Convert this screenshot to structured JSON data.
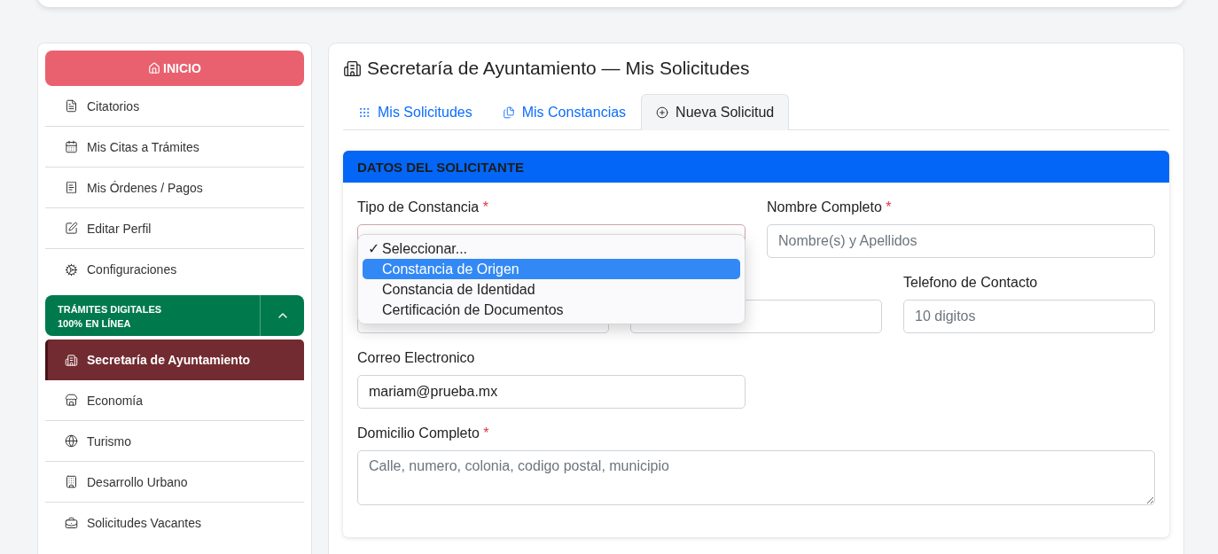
{
  "sidebar": {
    "home_button": "INICIO",
    "items": [
      {
        "label": "Citatorios"
      },
      {
        "label": "Mis Citas a Trámites"
      },
      {
        "label": "Mis Órdenes / Pagos"
      },
      {
        "label": "Editar Perfil"
      },
      {
        "label": "Configuraciones"
      }
    ],
    "section": {
      "title_lines": [
        "TRÁMITES DIGITALES",
        "100% EN LÍNEA"
      ],
      "expanded": true,
      "items": [
        {
          "label": "Secretaría de Ayuntamiento",
          "selected": true
        },
        {
          "label": "Economía",
          "selected": false
        },
        {
          "label": "Turismo",
          "selected": false
        },
        {
          "label": "Desarrollo Urbano",
          "selected": false
        },
        {
          "label": "Solicitudes Vacantes",
          "selected": false
        }
      ]
    }
  },
  "page": {
    "title": "Secretaría de Ayuntamiento — Mis Solicitudes",
    "tabs": [
      {
        "label": "Mis Solicitudes",
        "selected": false
      },
      {
        "label": "Mis Constancias",
        "selected": false
      },
      {
        "label": "Nueva Solicitud",
        "selected": true
      }
    ],
    "form": {
      "header": "DATOS DEL SOLICITANTE",
      "type_field": {
        "label": "Tipo de Constancia",
        "required_mark": "*",
        "invalid": true,
        "check_mark": "✓",
        "options": [
          {
            "label": "Seleccionar...",
            "checked": true,
            "highlighted": false
          },
          {
            "label": "Constancia de Origen",
            "checked": false,
            "highlighted": true
          },
          {
            "label": "Constancia de Identidad",
            "checked": false,
            "highlighted": false
          },
          {
            "label": "Certificación de Documentos",
            "checked": false,
            "highlighted": false
          }
        ]
      },
      "name_field": {
        "label": "Nombre Completo",
        "required_mark": "*",
        "placeholder": "Nombre(s) y Apellidos"
      },
      "phone_field": {
        "label": "Telefono de Contacto",
        "placeholder": "10 digitos"
      },
      "email_field": {
        "label": "Correo Electronico",
        "value": "mariam@prueba.mx"
      },
      "address_field": {
        "label": "Domicilio Completo",
        "required_mark": "*",
        "placeholder": "Calle, numero, colonia, codigo postal, municipio"
      }
    }
  }
}
